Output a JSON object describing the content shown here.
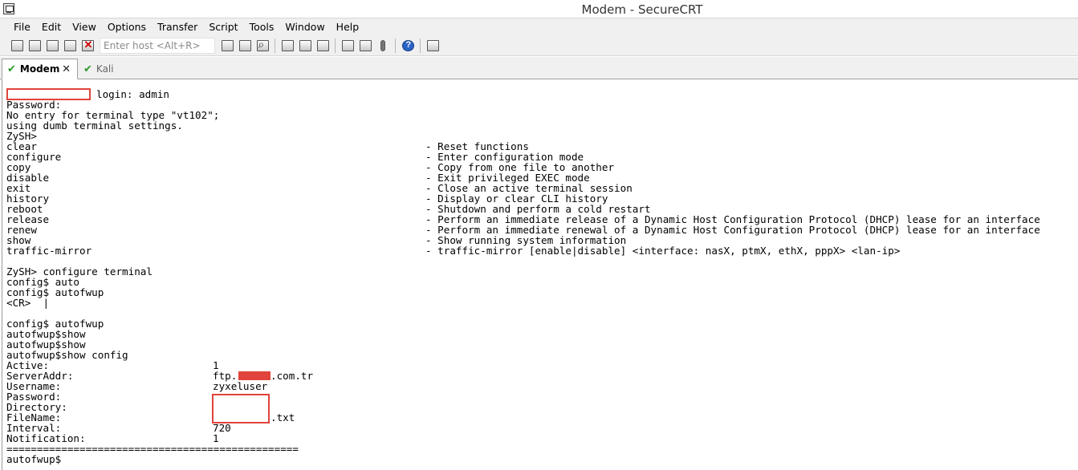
{
  "window": {
    "title": "Modem - SecureCRT"
  },
  "menu": [
    "File",
    "Edit",
    "View",
    "Options",
    "Transfer",
    "Script",
    "Tools",
    "Window",
    "Help"
  ],
  "toolbar": {
    "host_placeholder": "Enter host <Alt+R>"
  },
  "tabs": [
    {
      "label": "Modem",
      "active": true,
      "connected": true
    },
    {
      "label": "Kali",
      "active": false,
      "connected": true
    }
  ],
  "terminal": {
    "login_line": "login: admin",
    "intro": [
      "Password:",
      "No entry for terminal type \"vt102\";",
      "using dumb terminal settings.",
      "ZySH>"
    ],
    "commands": [
      {
        "name": "clear",
        "desc": "- Reset functions"
      },
      {
        "name": "configure",
        "desc": "- Enter configuration mode"
      },
      {
        "name": "copy",
        "desc": "- Copy from one file to another"
      },
      {
        "name": "disable",
        "desc": "- Exit privileged EXEC mode"
      },
      {
        "name": "exit",
        "desc": "- Close an active terminal session"
      },
      {
        "name": "history",
        "desc": "- Display or clear CLI history"
      },
      {
        "name": "reboot",
        "desc": "- Shutdown and perform a cold restart"
      },
      {
        "name": "release",
        "desc": "- Perform an immediate release of a Dynamic Host Configuration Protocol (DHCP) lease for an interface"
      },
      {
        "name": "renew",
        "desc": "- Perform an immediate renewal of a Dynamic Host Configuration Protocol (DHCP) lease for an interface"
      },
      {
        "name": "show",
        "desc": "- Show running system information"
      },
      {
        "name": "traffic-mirror",
        "desc": "- traffic-mirror [enable|disable] <interface: nasX, ptmX, ethX, pppX> <lan-ip>"
      }
    ],
    "session": [
      "ZySH> configure terminal",
      "config$ auto",
      "config$ autofwup",
      "<CR>  |",
      "",
      "config$ autofwup",
      "autofwup$show",
      "autofwup$show",
      "autofwup$show config"
    ],
    "config": [
      {
        "key": "Active:",
        "value": "1"
      },
      {
        "key": "ServerAddr:",
        "value": "ftp.",
        "suffix": ".com.tr"
      },
      {
        "key": "Username:",
        "value": "zyxeluser"
      },
      {
        "key": "Password:",
        "value": ""
      },
      {
        "key": "Directory:",
        "value": ""
      },
      {
        "key": "FileName:",
        "value": "",
        "suffix": ".txt"
      },
      {
        "key": "Interval:",
        "value": "720"
      },
      {
        "key": "Notification:",
        "value": "1"
      }
    ],
    "separator": "================================================",
    "prompt": "autofwup$"
  },
  "colors": {
    "redaction": "#e0443a",
    "connected_check": "#2a9a2a"
  }
}
